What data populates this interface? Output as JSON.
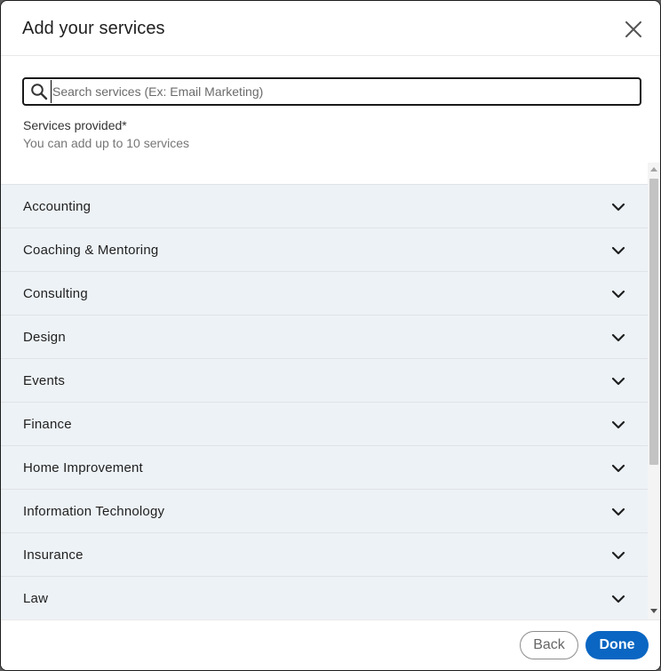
{
  "dialog": {
    "title": "Add your services",
    "close_icon": "close-icon"
  },
  "search": {
    "value": "",
    "placeholder": "Search services (Ex: Email Marketing)",
    "icon": "search-icon"
  },
  "services": {
    "label": "Services provided*",
    "hint": "You can add up to 10 services"
  },
  "categories": [
    {
      "label": "Accounting",
      "icon": "chevron-down-icon"
    },
    {
      "label": "Coaching & Mentoring",
      "icon": "chevron-down-icon"
    },
    {
      "label": "Consulting",
      "icon": "chevron-down-icon"
    },
    {
      "label": "Design",
      "icon": "chevron-down-icon"
    },
    {
      "label": "Events",
      "icon": "chevron-down-icon"
    },
    {
      "label": "Finance",
      "icon": "chevron-down-icon"
    },
    {
      "label": "Home Improvement",
      "icon": "chevron-down-icon"
    },
    {
      "label": "Information Technology",
      "icon": "chevron-down-icon"
    },
    {
      "label": "Insurance",
      "icon": "chevron-down-icon"
    },
    {
      "label": "Law",
      "icon": "chevron-down-icon"
    }
  ],
  "footer": {
    "back_label": "Back",
    "done_label": "Done"
  },
  "colors": {
    "primary": "#0a66c2",
    "list_background": "#edf2f6"
  }
}
